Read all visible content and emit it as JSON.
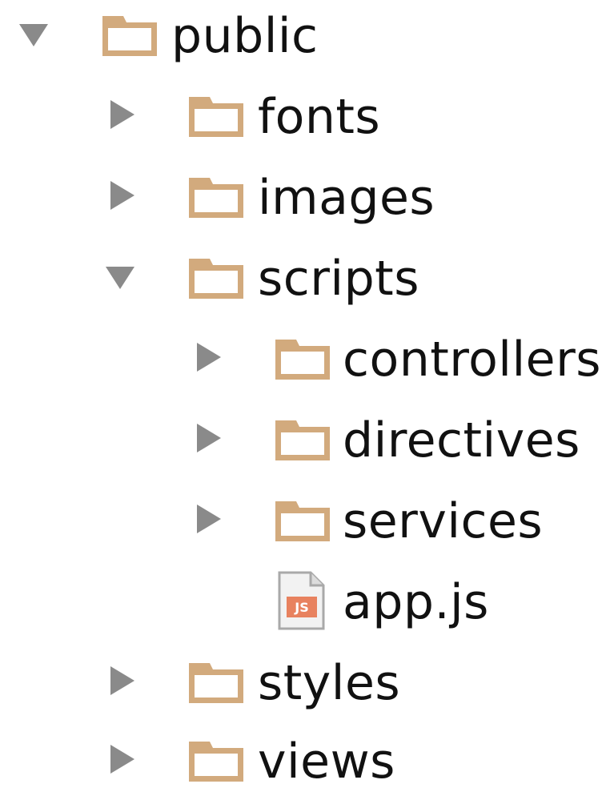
{
  "tree": {
    "items": [
      {
        "label": "public",
        "kind": "folder",
        "state": "expanded",
        "depth": 0
      },
      {
        "label": "fonts",
        "kind": "folder",
        "state": "collapsed",
        "depth": 1
      },
      {
        "label": "images",
        "kind": "folder",
        "state": "collapsed",
        "depth": 1
      },
      {
        "label": "scripts",
        "kind": "folder",
        "state": "expanded",
        "depth": 1
      },
      {
        "label": "controllers",
        "kind": "folder",
        "state": "collapsed",
        "depth": 2
      },
      {
        "label": "directives",
        "kind": "folder",
        "state": "collapsed",
        "depth": 2
      },
      {
        "label": "services",
        "kind": "folder",
        "state": "collapsed",
        "depth": 2
      },
      {
        "label": "app.js",
        "kind": "file",
        "file_type": "js",
        "badge": "JS",
        "depth": 2
      },
      {
        "label": "styles",
        "kind": "folder",
        "state": "collapsed",
        "depth": 1
      },
      {
        "label": "views",
        "kind": "folder",
        "state": "collapsed",
        "depth": 1
      }
    ]
  },
  "icons": {
    "folder": "folder-icon",
    "expanded": "triangle-down-icon",
    "collapsed": "triangle-right-icon",
    "js_file": "js-file-icon"
  },
  "colors": {
    "folder": "#d2aa7d",
    "disclosure": "#8a8a8a",
    "text": "#111111",
    "js_badge": "#e8825f"
  }
}
